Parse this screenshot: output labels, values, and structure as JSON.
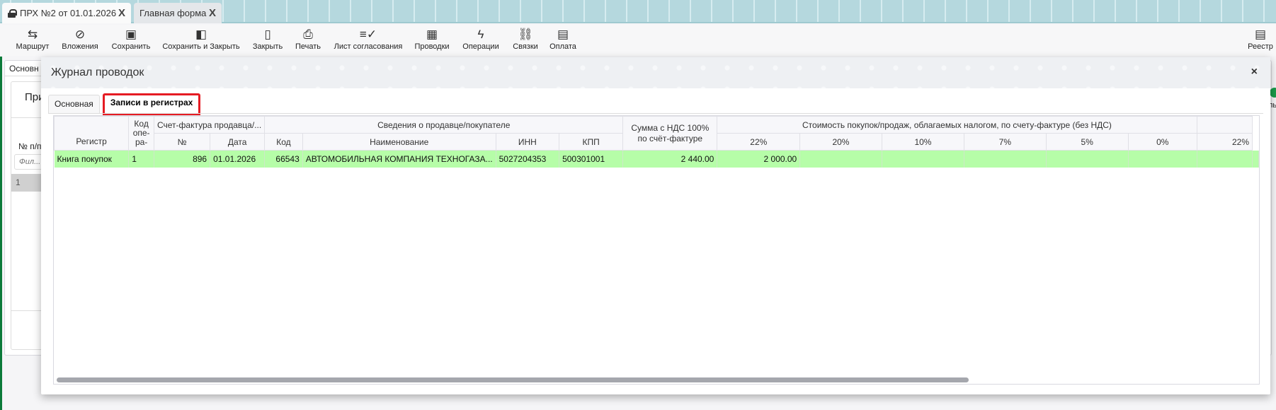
{
  "tabs": [
    {
      "label": "ПРХ №2 от 01.01.2026",
      "icon": "lock-icon"
    },
    {
      "label": "Главная форма"
    }
  ],
  "tab_close": "X",
  "toolbar": [
    {
      "label": "Маршрут",
      "icon": "route-icon",
      "glyph": "⇆"
    },
    {
      "label": "Вложения",
      "icon": "paperclip-icon",
      "glyph": "⊘"
    },
    {
      "label": "Сохранить",
      "icon": "save-icon",
      "glyph": "▣"
    },
    {
      "label": "Сохранить и Закрыть",
      "icon": "save-close-icon",
      "glyph": "◧"
    },
    {
      "label": "Закрыть",
      "icon": "close-door-icon",
      "glyph": "▯"
    },
    {
      "label": "Печать",
      "icon": "print-icon",
      "glyph": "⎙"
    },
    {
      "label": "Лист согласования",
      "icon": "checklist-icon",
      "glyph": "≡✓"
    },
    {
      "label": "Проводки",
      "icon": "calculator-icon",
      "glyph": "▦"
    },
    {
      "label": "Операции",
      "icon": "lightning-icon",
      "glyph": "ϟ"
    },
    {
      "label": "Связки",
      "icon": "link-icon",
      "glyph": "⛓"
    },
    {
      "label": "Оплата",
      "icon": "money-icon",
      "glyph": "▤"
    }
  ],
  "registry": {
    "label": "Реестр",
    "glyph": "▤"
  },
  "mainform": {
    "tab": "Основн",
    "section": "При",
    "col": "№ п/п",
    "filter_placeholder": "Фил...",
    "row": "1",
    "right_label": "льт"
  },
  "modal": {
    "title": "Журнал проводок",
    "close": "×",
    "tabs": [
      "Основная",
      "Записи в регистрах"
    ],
    "header_top": {
      "register": "Регистр",
      "op_code": "Код опе-ра-",
      "invoice": "Счет-фактура продавца/...",
      "seller": "Сведения о продавце/покупателе",
      "sum": "Сумма с НДС 100% по счёт-фактуре",
      "cost": "Стоимость покупок/продаж, облагаемых налогом, по счету-фактуре (без НДС)"
    },
    "header_sub": [
      "№",
      "Дата",
      "Код",
      "Наименование",
      "ИНН",
      "КПП",
      "22%",
      "20%",
      "10%",
      "7%",
      "5%",
      "0%",
      "22%"
    ],
    "rows": [
      [
        "Книга покупок",
        "1",
        "896",
        "01.01.2026",
        "66543",
        "АВТОМОБИЛЬНАЯ КОМПАНИЯ ТЕХНОГАЗА...",
        "5027204353",
        "500301001",
        "2 440.00",
        "2 000.00",
        "",
        "",
        "",
        "",
        "",
        "",
        ""
      ]
    ],
    "accent": "#b6fda8"
  }
}
